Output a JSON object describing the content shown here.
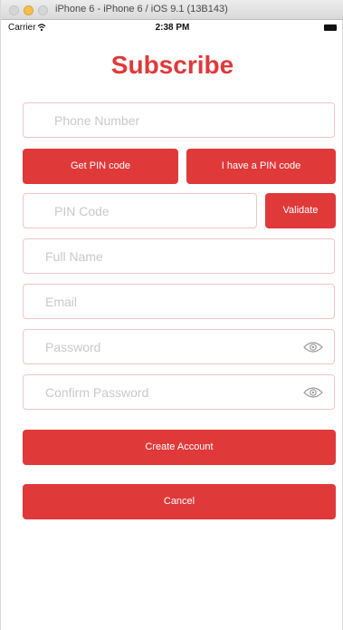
{
  "window": {
    "title": "iPhone 6 - iPhone 6 / iOS 9.1 (13B143)"
  },
  "status_bar": {
    "carrier": "Carrier",
    "time": "2:38 PM"
  },
  "page": {
    "title": "Subscribe"
  },
  "form": {
    "phone_placeholder": "Phone Number",
    "get_pin_label": "Get PIN code",
    "have_pin_label": "I have a PIN code",
    "pin_placeholder": "PIN Code",
    "validate_label": "Validate",
    "fullname_placeholder": "Full Name",
    "email_placeholder": "Email",
    "password_placeholder": "Password",
    "confirm_password_placeholder": "Confirm Password",
    "create_account_label": "Create Account",
    "cancel_label": "Cancel"
  },
  "icons": {
    "password_toggle": "eye-icon",
    "confirm_password_toggle": "eye-icon"
  },
  "colors": {
    "accent": "#e0393a",
    "field_border": "#f0c6c4",
    "placeholder": "#c9c9c9"
  }
}
